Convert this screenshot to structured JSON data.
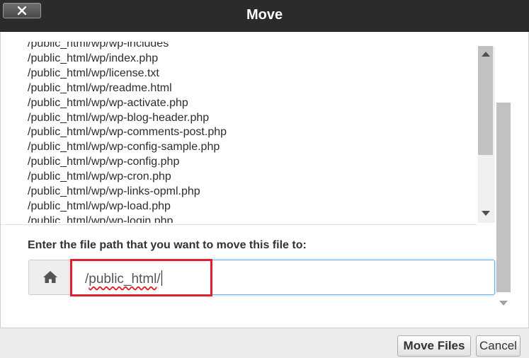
{
  "dialog": {
    "title": "Move"
  },
  "file_list": [
    "/public_html/wp/wp-includes",
    "/public_html/wp/index.php",
    "/public_html/wp/license.txt",
    "/public_html/wp/readme.html",
    "/public_html/wp/wp-activate.php",
    "/public_html/wp/wp-blog-header.php",
    "/public_html/wp/wp-comments-post.php",
    "/public_html/wp/wp-config-sample.php",
    "/public_html/wp/wp-config.php",
    "/public_html/wp/wp-cron.php",
    "/public_html/wp/wp-links-opml.php",
    "/public_html/wp/wp-load.php",
    "/public_html/wp/wp-login.php"
  ],
  "destination": {
    "label": "Enter the file path that you want to move this file to:",
    "prefix": "/",
    "misspelled": "public_html",
    "suffix": "/"
  },
  "buttons": {
    "move": "Move Files",
    "cancel": "Cancel"
  },
  "colors": {
    "titlebar": "#2b2b2b",
    "highlight": "#e0202c",
    "input_focus": "#66afe9"
  },
  "icons": {
    "close": "close-icon",
    "home": "home-icon"
  }
}
